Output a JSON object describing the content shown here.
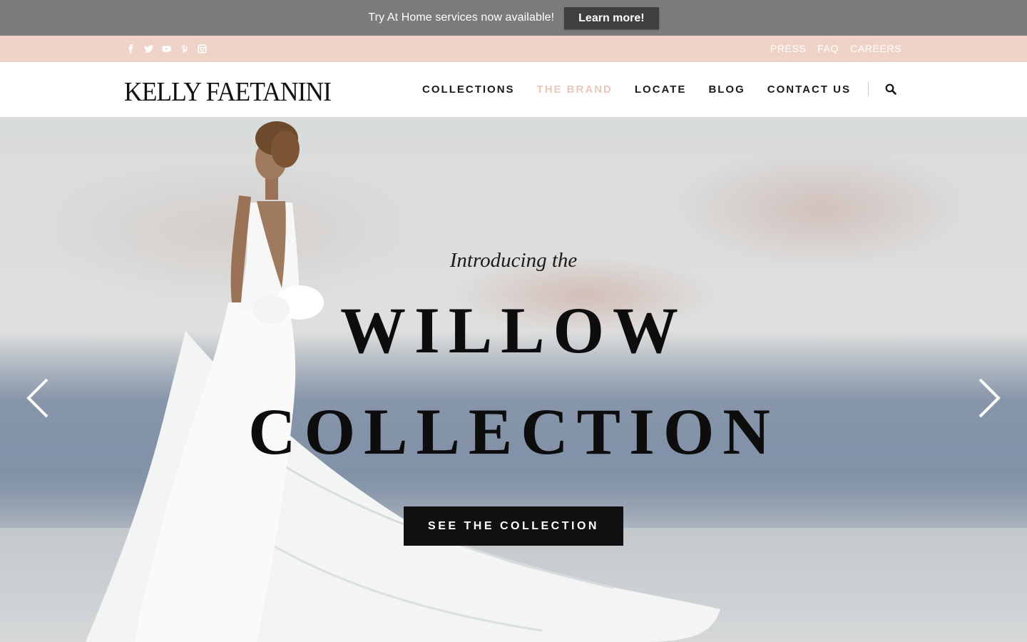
{
  "announcement": {
    "text": "Try At Home services now available!",
    "button_label": "Learn more!"
  },
  "utility_bar": {
    "socials": [
      "facebook-icon",
      "twitter-icon",
      "youtube-icon",
      "pinterest-icon",
      "instagram-icon"
    ],
    "links": [
      "PRESS",
      "FAQ",
      "CAREERS"
    ]
  },
  "header": {
    "logo": "Kelly Faetanini",
    "nav": [
      {
        "label": "COLLECTIONS",
        "active": false
      },
      {
        "label": "THE BRAND",
        "active": true
      },
      {
        "label": "LOCATE",
        "active": false
      },
      {
        "label": "BLOG",
        "active": false
      },
      {
        "label": "CONTACT US",
        "active": false
      }
    ],
    "search_icon": "search-icon"
  },
  "hero": {
    "intro": "Introducing the",
    "title_line1": "WILLOW",
    "title_line2": "COLLECTION",
    "cta_label": "SEE THE COLLECTION",
    "prev_icon": "chevron-left-icon",
    "next_icon": "chevron-right-icon"
  },
  "colors": {
    "announce_bg": "#7b7b7b",
    "util_bg": "#efd3c8",
    "accent_active": "#e8c7bb",
    "cta_bg": "#111111"
  }
}
